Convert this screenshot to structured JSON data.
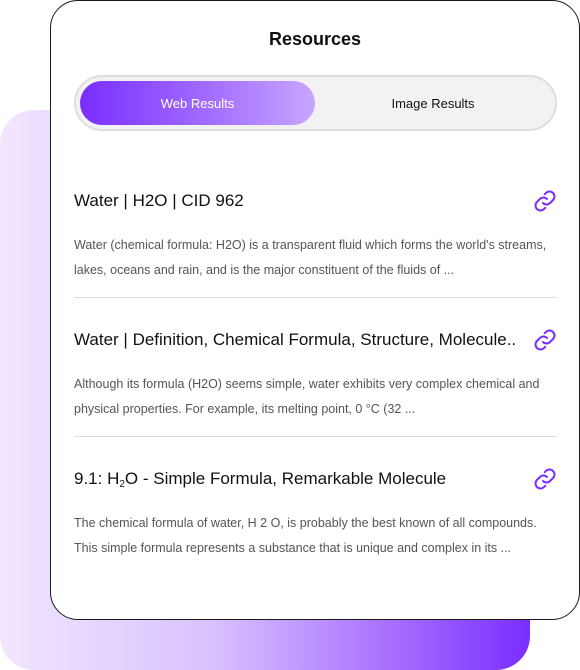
{
  "panel": {
    "title": "Resources"
  },
  "tabs": [
    {
      "label": "Web Results",
      "active": true
    },
    {
      "label": "Image Results",
      "active": false
    }
  ],
  "results": [
    {
      "title": "Water | H2O | CID 962",
      "snippet": "Water (chemical formula: H2O) is a transparent fluid which forms the world's streams, lakes, oceans and rain, and is the major constituent of the fluids of ..."
    },
    {
      "title": "Water | Definition, Chemical Formula, Structure, Molecule..",
      "snippet": "Although its formula (H2O) seems simple, water exhibits very complex chemical and physical properties. For example, its melting point, 0 °C (32 ..."
    },
    {
      "title_prefix": "9.1: H",
      "title_sub": "2",
      "title_suffix": "O - Simple Formula, Remarkable Molecule",
      "snippet": "The chemical formula of water, H 2 O, is probably the best known of all compounds. This simple formula represents a substance that is unique and complex in its ..."
    }
  ],
  "colors": {
    "accent": "#7a2dff",
    "link_icon": "#7a2dff"
  },
  "icons": {
    "result_link": "link-icon"
  }
}
